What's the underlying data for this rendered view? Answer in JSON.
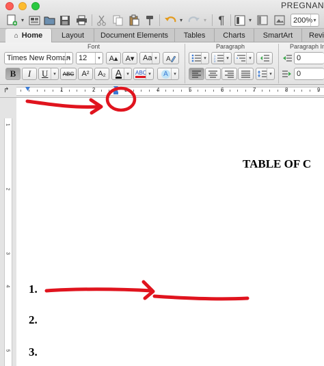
{
  "window": {
    "title": "PREGNAN"
  },
  "toolbar": {
    "zoom_value": "200%"
  },
  "tabs": [
    {
      "label": "Home",
      "active": true
    },
    {
      "label": "Layout"
    },
    {
      "label": "Document Elements"
    },
    {
      "label": "Tables"
    },
    {
      "label": "Charts"
    },
    {
      "label": "SmartArt"
    },
    {
      "label": "Revi"
    }
  ],
  "ribbon": {
    "groups": {
      "font": "Font",
      "paragraph": "Paragraph",
      "paragraph_indents": "Paragraph Inde"
    },
    "font_name": "Times New Roman",
    "font_size": "12",
    "bold": "B",
    "italic": "I",
    "underline": "U",
    "strike": "ABC",
    "superscript": "A²",
    "subscript": "A₂",
    "grow": "A▴",
    "shrink": "A▾",
    "case": "Aa",
    "font_color_letter": "A",
    "highlight": "ABC",
    "text_effect": "A",
    "indent_left": "0",
    "indent_right": "0"
  },
  "ruler": {
    "numbers": [
      "1",
      "2",
      "3",
      "4",
      "5",
      "6",
      "7",
      "8",
      "9"
    ]
  },
  "vruler": {
    "numbers": [
      "1",
      "2",
      "3",
      "4",
      "5"
    ]
  },
  "document": {
    "heading": "TABLE OF C",
    "list_numbers": [
      "1.",
      "2.",
      "3."
    ]
  },
  "colors": {
    "annotation": "#e0141e",
    "accent": "#3b7bd5"
  }
}
